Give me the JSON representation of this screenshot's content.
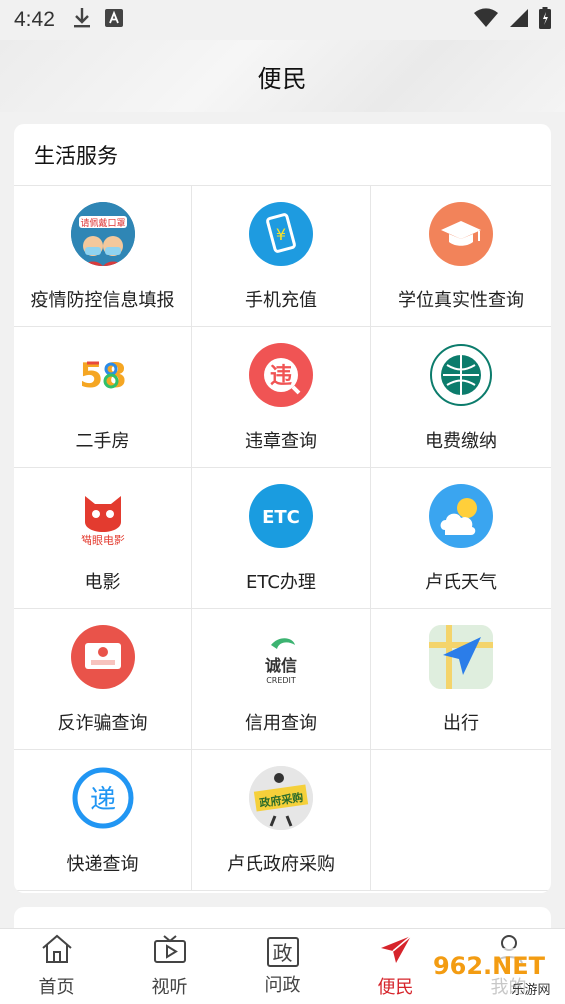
{
  "status_bar": {
    "time": "4:42",
    "icons": [
      "download-icon",
      "a-icon",
      "wifi-icon",
      "signal-icon",
      "battery-icon"
    ]
  },
  "header": {
    "title": "便民"
  },
  "section": {
    "title": "生活服务",
    "items": [
      {
        "label": "疫情防控信息填报",
        "icon": "mask-icon",
        "badge_text": "请佩戴口罩"
      },
      {
        "label": "手机充值",
        "icon": "phone-recharge-icon",
        "color": "#1e9be0"
      },
      {
        "label": "学位真实性查询",
        "icon": "graduation-cap-icon",
        "color": "#f2835a"
      },
      {
        "label": "二手房",
        "icon": "58-icon",
        "logo_text": "58"
      },
      {
        "label": "违章查询",
        "icon": "violation-icon",
        "color": "#f05454",
        "logo_text": "违"
      },
      {
        "label": "电费缴纳",
        "icon": "state-grid-icon",
        "color": "#0c7c6c"
      },
      {
        "label": "电影",
        "icon": "maoyan-icon",
        "color": "#e33b2f",
        "logo_text": "猫眼电影"
      },
      {
        "label": "ETC办理",
        "icon": "etc-icon",
        "color": "#1a9ce0",
        "logo_text": "ETC"
      },
      {
        "label": "卢氏天气",
        "icon": "weather-icon",
        "color": "#3aa5f0"
      },
      {
        "label": "反诈骗查询",
        "icon": "anti-fraud-icon",
        "color": "#e9534a"
      },
      {
        "label": "信用查询",
        "icon": "credit-icon",
        "logo_text": "诚信",
        "logo_sub": "CREDIT"
      },
      {
        "label": "出行",
        "icon": "navigation-icon",
        "color": "#2b7de9"
      },
      {
        "label": "快递查询",
        "icon": "express-icon",
        "color": "#2196f3",
        "logo_text": "递"
      },
      {
        "label": "卢氏政府采购",
        "icon": "gov-purchase-icon",
        "logo_text": "政府采购"
      }
    ]
  },
  "nav": {
    "items": [
      {
        "label": "首页",
        "icon": "home-icon"
      },
      {
        "label": "视听",
        "icon": "tv-icon"
      },
      {
        "label": "问政",
        "icon": "zheng-icon",
        "glyph": "政"
      },
      {
        "label": "便民",
        "icon": "send-icon",
        "active": true
      },
      {
        "label": "我的",
        "icon": "user-icon"
      }
    ]
  },
  "watermark": {
    "text": "962.NET",
    "sub": "乐游网"
  },
  "colors": {
    "accent": "#d6242b",
    "divider": "#e6e6e6",
    "background": "#f1f1f1"
  }
}
